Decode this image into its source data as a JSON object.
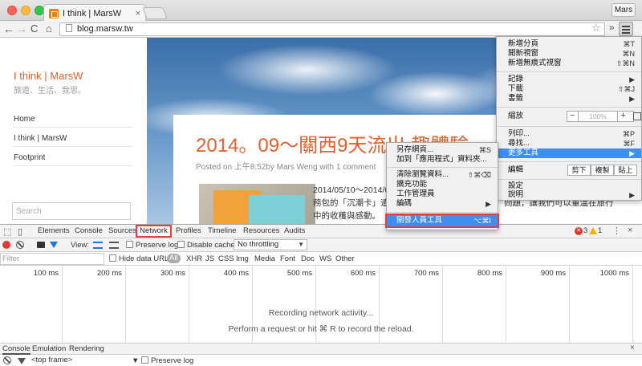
{
  "window": {
    "tab_title": "I think | MarsW",
    "tab_close": "×",
    "profile": "Mars"
  },
  "toolbar": {
    "back": "←",
    "forward": "→",
    "reload": "C",
    "home": "⌂",
    "url": "blog.marsw.tw",
    "star": "☆",
    "overflow": "»"
  },
  "sidebar": {
    "site_title": "I think | MarsW",
    "tagline": "旅遊、生活、我思。",
    "nav": [
      "Home",
      "I think | MarsW",
      "Footprint"
    ],
    "search_placeholder": "Search"
  },
  "post": {
    "title": "2014。09～關西9天流出 趣體驗",
    "meta": "Posted on 上午8:52by Mars Weng with 1 comment",
    "text_lines": [
      "2014/05/10～2014/05",
      "務包的「沉潮卡」遣",
      "中的收穫與感動。"
    ],
    "text_right": [
      "問題，讓我們可以重溫在旅行"
    ]
  },
  "devtools": {
    "tabs": [
      "Elements",
      "Console",
      "Sources",
      "Network",
      "Profiles",
      "Timeline",
      "Resources",
      "Audits"
    ],
    "active_tab": "Network",
    "error_count": "3",
    "warning_count": "1",
    "more": "⋮",
    "close": "×",
    "view_label": "View:",
    "preserve_log": "Preserve log",
    "disable_cache": "Disable cache",
    "throttling": "No throttling",
    "filter_placeholder": "Filter",
    "hide_data_urls": "Hide data URLs",
    "type_filters": [
      "All",
      "XHR",
      "JS",
      "CSS",
      "Img",
      "Media",
      "Font",
      "Doc",
      "WS",
      "Other"
    ],
    "ticks": [
      "100 ms",
      "200 ms",
      "300 ms",
      "400 ms",
      "500 ms",
      "600 ms",
      "700 ms",
      "800 ms",
      "900 ms",
      "1000 ms"
    ],
    "recording_msg": "Recording network activity...",
    "perform_msg": "Perform a request or hit ⌘ R to record the reload.",
    "drawer_tabs": [
      "Console",
      "Emulation",
      "Rendering"
    ],
    "drawer_close": "×",
    "frame": "<top frame>",
    "console_preserve_log": "Preserve log"
  },
  "main_menu": {
    "items": [
      {
        "label": "新增分頁",
        "shortcut": "⌘T"
      },
      {
        "label": "開新視窗",
        "shortcut": "⌘N"
      },
      {
        "label": "新增無痕式視窗",
        "shortcut": "⇧⌘N"
      },
      {
        "label": "記錄",
        "shortcut": "▶"
      },
      {
        "label": "下載",
        "shortcut": "⇧⌘J"
      },
      {
        "label": "書籤",
        "shortcut": "▶"
      },
      {
        "label": "縮放",
        "shortcut": ""
      },
      {
        "label": "列印...",
        "shortcut": "⌘P"
      },
      {
        "label": "尋找...",
        "shortcut": "⌘F"
      },
      {
        "label": "更多工具",
        "shortcut": "▶"
      },
      {
        "label": "編輯",
        "shortcut": ""
      },
      {
        "label": "設定",
        "shortcut": ""
      },
      {
        "label": "說明",
        "shortcut": "▶"
      }
    ],
    "zoom_minus": "−",
    "zoom_value": "100%",
    "zoom_plus": "+",
    "edit_cut": "剪下",
    "edit_copy": "複製",
    "edit_paste": "貼上"
  },
  "sub_menu": {
    "items": [
      {
        "label": "另存網頁...",
        "shortcut": "⌘S"
      },
      {
        "label": "加到「應用程式」資料夾...",
        "shortcut": ""
      },
      {
        "label": "清除瀏覽資料...",
        "shortcut": "⇧⌘⌫"
      },
      {
        "label": "擴充功能",
        "shortcut": ""
      },
      {
        "label": "工作管理員",
        "shortcut": ""
      },
      {
        "label": "編碼",
        "shortcut": "▶"
      },
      {
        "label": "開發人員工具",
        "shortcut": "⌥⌘I"
      }
    ]
  }
}
